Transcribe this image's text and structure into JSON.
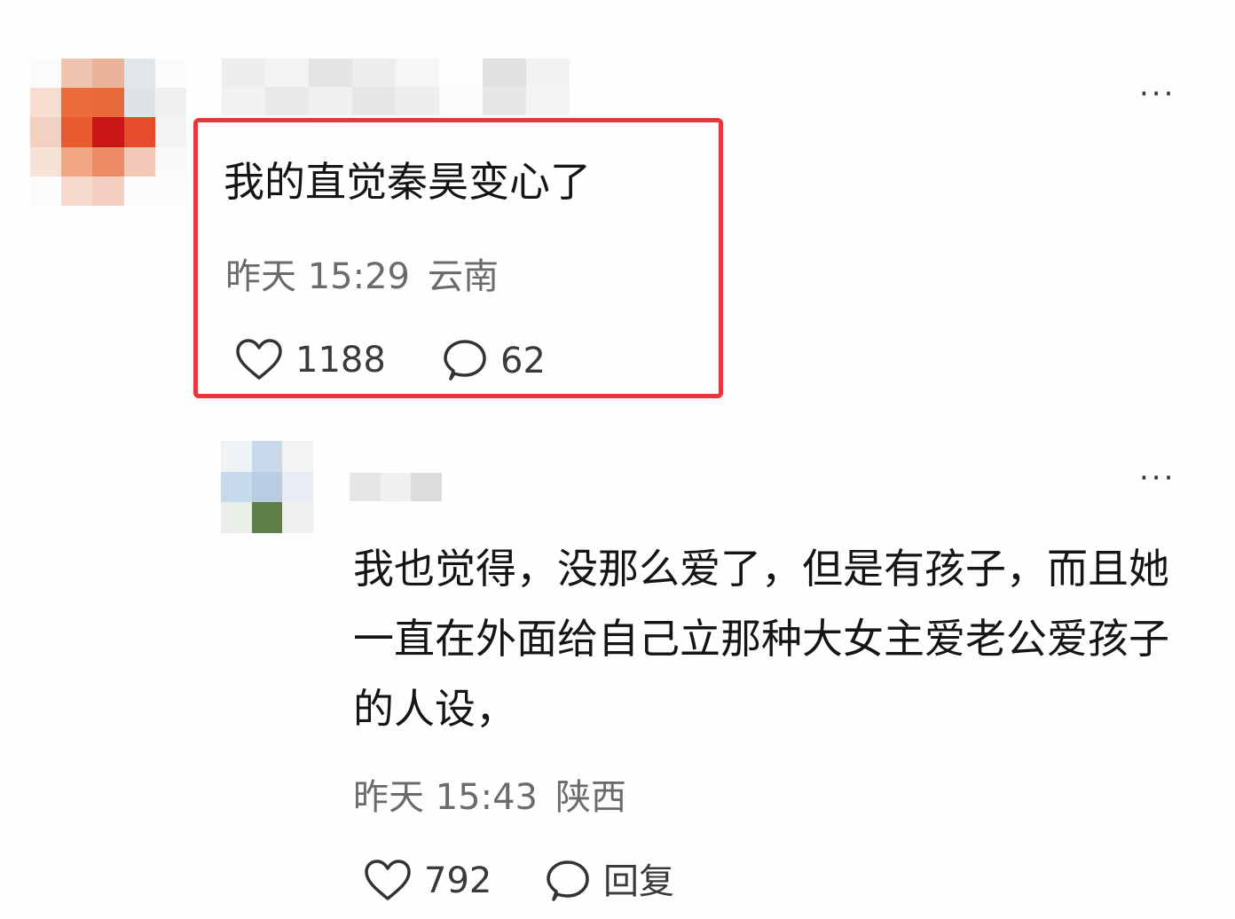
{
  "colors": {
    "highlight_border": "#e4393c",
    "text_primary": "#151515",
    "text_meta": "#6b6b6b",
    "background": "#fefefe"
  },
  "icons": {
    "like": "heart-outline-icon",
    "comment": "speech-bubble-icon",
    "more": "ellipsis-icon"
  },
  "comments": [
    {
      "text": "我的直觉秦昊变心了",
      "time": "昨天 15:29",
      "location": "云南",
      "likes": "1188",
      "replies": "62",
      "more_label": "···"
    },
    {
      "text": "我也觉得，没那么爱了，但是有孩子，而且她一直在外面给自己立那种大女主爱老公爱孩子的人设，",
      "time": "昨天 15:43",
      "location": "陕西",
      "likes": "792",
      "reply_label": "回复",
      "more_label": "···"
    }
  ]
}
